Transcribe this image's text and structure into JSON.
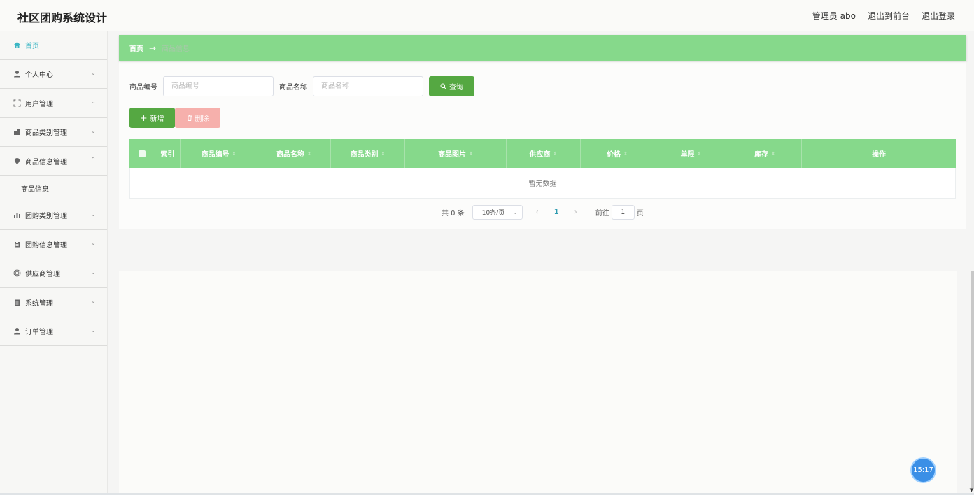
{
  "header": {
    "title": "社区团购系统设计",
    "admin": "管理员 abo",
    "to_frontend": "退出到前台",
    "logout": "退出登录"
  },
  "sidebar": {
    "items": [
      {
        "label": "首页",
        "icon": "home-icon"
      },
      {
        "label": "个人中心",
        "icon": "user-icon"
      },
      {
        "label": "用户管理",
        "icon": "frame-icon"
      },
      {
        "label": "商品类别管理",
        "icon": "tag-icon"
      },
      {
        "label": "商品信息管理",
        "icon": "pin-icon"
      },
      {
        "label": "商品信息",
        "icon": ""
      },
      {
        "label": "团购类别管理",
        "icon": "bar-chart-icon"
      },
      {
        "label": "团购信息管理",
        "icon": "clipboard-icon"
      },
      {
        "label": "供应商管理",
        "icon": "circle-icon"
      },
      {
        "label": "系统管理",
        "icon": "document-icon"
      },
      {
        "label": "订单管理",
        "icon": "user-icon"
      }
    ]
  },
  "breadcrumb": {
    "home": "首页",
    "arrow": "→",
    "current": "商品信息"
  },
  "search": {
    "code_label": "商品编号",
    "code_placeholder": "商品编号",
    "name_label": "商品名称",
    "name_placeholder": "商品名称",
    "query_button": "查询"
  },
  "actions": {
    "add": "新增",
    "delete": "删除"
  },
  "table": {
    "columns": [
      "索引",
      "商品编号",
      "商品名称",
      "商品类别",
      "商品图片",
      "供应商",
      "价格",
      "单限",
      "库存",
      "操作"
    ],
    "empty_text": "暂无数据"
  },
  "pagination": {
    "total": "共 0 条",
    "page_size": "10条/页",
    "current_page": "1",
    "goto_label": "前往",
    "goto_value": "1",
    "page_suffix": "页"
  },
  "clock": "15:17",
  "colors": {
    "accent_green": "#86d98b",
    "button_green": "#55a842",
    "delete_pink": "#f6b0ac",
    "active_teal": "#3cb6c4"
  }
}
